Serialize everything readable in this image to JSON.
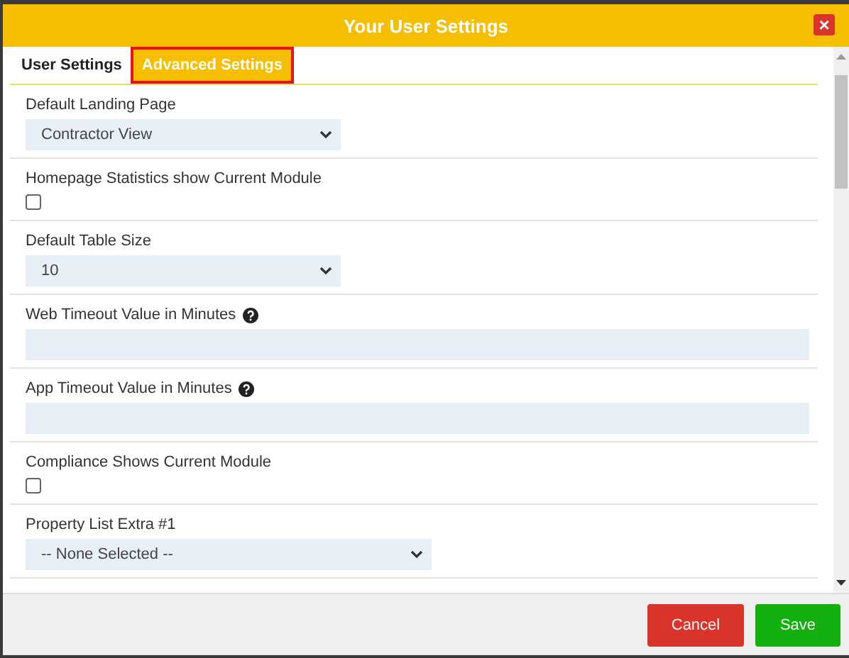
{
  "window": {
    "title": "Your User Settings",
    "close": "×"
  },
  "tabs": [
    {
      "label": "User Settings",
      "selected": false
    },
    {
      "label": "Advanced Settings",
      "selected": true
    }
  ],
  "fields": [
    {
      "kind": "select",
      "label": "Default Landing Page",
      "value": "Contractor View",
      "help": false
    },
    {
      "kind": "checkbox",
      "label": "Homepage Statistics show Current Module",
      "checked": false,
      "help": false
    },
    {
      "kind": "select",
      "label": "Default Table Size",
      "value": "10",
      "help": false
    },
    {
      "kind": "text",
      "label": "Web Timeout Value in Minutes",
      "help": true
    },
    {
      "kind": "text",
      "label": "App Timeout Value in Minutes",
      "help": true
    },
    {
      "kind": "checkbox",
      "label": "Compliance Shows Current Module",
      "checked": false,
      "help": false
    },
    {
      "kind": "select",
      "label": "Property List Extra #1",
      "value": "-- None Selected --",
      "help": false,
      "wide": true
    }
  ],
  "buttons": [
    {
      "kind": "cancel",
      "label": "Cancel"
    },
    {
      "kind": "save",
      "label": "Save"
    }
  ]
}
